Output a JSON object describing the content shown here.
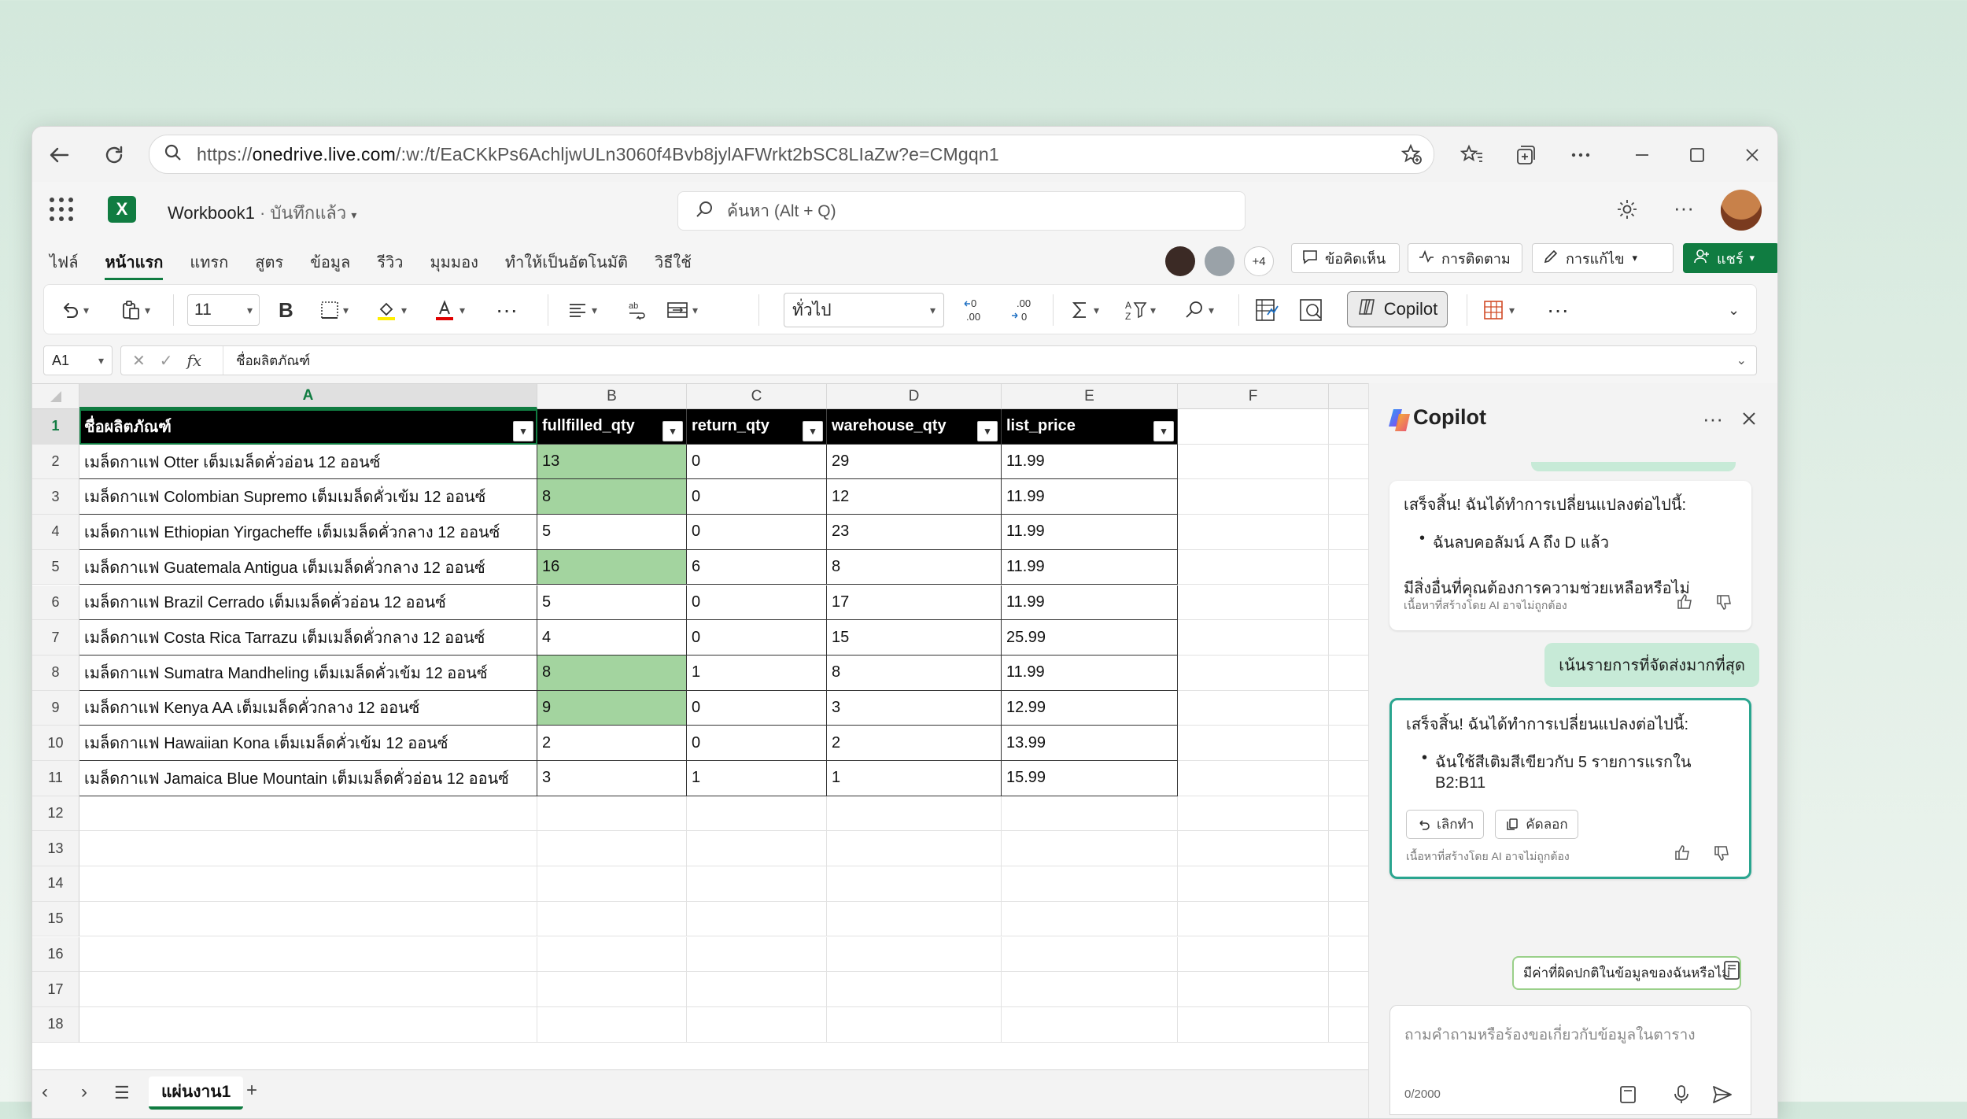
{
  "browser": {
    "url_prefix": "https://",
    "url_domain": "onedrive.live.com",
    "url_rest": "/:w:/t/EaCKkPs6AchljwULn3060f4Bvb8jylAFWrkt2bSC8LIaZw?e=CMgqn1"
  },
  "app": {
    "logo": "X",
    "workbook_name": "Workbook1",
    "save_status": " · บันทึกแล้ว",
    "search_placeholder": "ค้นหา (Alt + Q)",
    "extra_people": "+4",
    "comments_label": "ข้อคิดเห็น",
    "catchup_label": "การติดตาม",
    "editing_label": "การแก้ไข",
    "share_label": "แชร์"
  },
  "tabs": [
    "ไฟล์",
    "หน้าแรก",
    "แทรก",
    "สูตร",
    "ข้อมูล",
    "รีวิว",
    "มุมมอง",
    "ทำให้เป็นอัตโนมัติ",
    "วิธีใช้"
  ],
  "ribbon": {
    "font_size": "11",
    "bold": "B",
    "number_format": "ทั่วไป",
    "copilot_label": "Copilot",
    "dec_inc": "←0\n.00",
    "dec_dec": ".00\n→0"
  },
  "formula_bar": {
    "cell_ref": "A1",
    "content": "ชื่อผลิตภัณฑ์"
  },
  "columns": [
    "A",
    "B",
    "C",
    "D",
    "E",
    "F"
  ],
  "rows": [
    "1",
    "2",
    "3",
    "4",
    "5",
    "6",
    "7",
    "8",
    "9",
    "10",
    "11",
    "12",
    "13",
    "14",
    "15",
    "16",
    "17",
    "18"
  ],
  "table": {
    "headers": [
      "ชื่อผลิตภัณฑ์",
      "fullfilled_qty",
      "return_qty",
      "warehouse_qty",
      "list_price"
    ],
    "rows": [
      [
        "เมล็ดกาแฟ Otter เต็มเมล็ดคั่วอ่อน 12 ออนซ์",
        "13",
        "0",
        "29",
        "11.99"
      ],
      [
        "เมล็ดกาแฟ Colombian Supremo เต็มเมล็ดคั่วเข้ม 12 ออนซ์",
        "8",
        "0",
        "12",
        "11.99"
      ],
      [
        "เมล็ดกาแฟ Ethiopian Yirgacheffe เต็มเมล็ดคั่วกลาง 12 ออนซ์",
        "5",
        "0",
        "23",
        "11.99"
      ],
      [
        "เมล็ดกาแฟ Guatemala Antigua เต็มเมล็ดคั่วกลาง 12 ออนซ์",
        "16",
        "6",
        "8",
        "11.99"
      ],
      [
        "เมล็ดกาแฟ Brazil Cerrado เต็มเมล็ดคั่วอ่อน 12 ออนซ์",
        "5",
        "0",
        "17",
        "11.99"
      ],
      [
        "เมล็ดกาแฟ Costa Rica Tarrazu เต็มเมล็ดคั่วกลาง 12 ออนซ์",
        "4",
        "0",
        "15",
        "25.99"
      ],
      [
        "เมล็ดกาแฟ Sumatra Mandheling เต็มเมล็ดคั่วเข้ม 12 ออนซ์",
        "8",
        "1",
        "8",
        "11.99"
      ],
      [
        "เมล็ดกาแฟ Kenya AA เต็มเมล็ดคั่วกลาง 12 ออนซ์",
        "9",
        "0",
        "3",
        "12.99"
      ],
      [
        "เมล็ดกาแฟ Hawaiian Kona เต็มเมล็ดคั่วเข้ม 12 ออนซ์",
        "2",
        "0",
        "2",
        "13.99"
      ],
      [
        "เมล็ดกาแฟ Jamaica Blue Mountain เต็มเมล็ดคั่วอ่อน 12 ออนซ์",
        "3",
        "1",
        "1",
        "15.99"
      ]
    ],
    "highlight_rows": [
      0,
      1,
      3,
      6,
      7
    ],
    "highlight_color": "#a3d49f"
  },
  "sheet": {
    "tab_name": "แผ่นงาน1",
    "add": "+"
  },
  "copilot": {
    "title": "Copilot",
    "card1": {
      "heading": "เสร็จสิ้น! ฉันได้ทำการเปลี่ยนแปลงต่อไปนี้:",
      "bullet": "ฉันลบคอลัมน์ A ถึง D แล้ว",
      "followup": "มีสิ่งอื่นที่คุณต้องการความช่วยเหลือหรือไม่",
      "disclaimer": "เนื้อหาที่สร้างโดย AI อาจไม่ถูกต้อง"
    },
    "user_message": "เน้นรายการที่จัดส่งมากที่สุด",
    "card2": {
      "heading": "เสร็จสิ้น! ฉันได้ทำการเปลี่ยนแปลงต่อไปนี้:",
      "bullet": "ฉันใช้สีเติมสีเขียวกับ 5 รายการแรกใน B2:B11",
      "undo_label": "เลิกทำ",
      "copy_label": "คัดลอก",
      "disclaimer": "เนื้อหาที่สร้างโดย AI อาจไม่ถูกต้อง"
    },
    "suggestion": "มีค่าที่ผิดปกติในข้อมูลของฉันหรือไม่",
    "input_placeholder": "ถามคำถามหรือร้องขอเกี่ยวกับข้อมูลในตาราง",
    "char_count": "0/2000"
  },
  "colors": {
    "excel_green": "#107c41",
    "accent_teal": "#2aa58f"
  }
}
